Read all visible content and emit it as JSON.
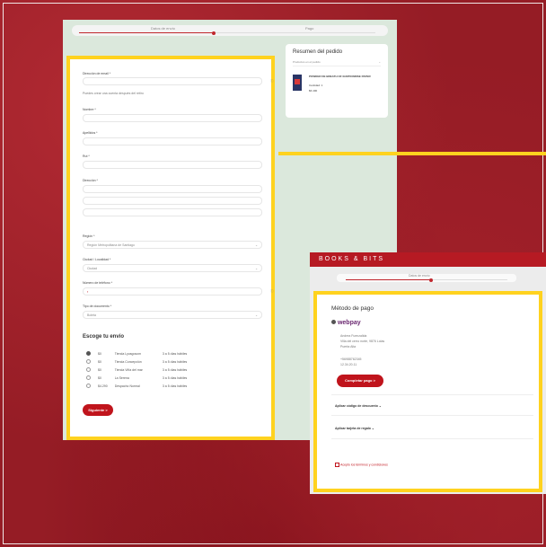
{
  "checkout_form": {
    "progress_label": "Datos de envío",
    "progress_label_right": "Pago",
    "email_label": "Dirección de email *",
    "account_hint": "Puedes crear una cuenta después del retiro",
    "first_name_label": "Nombre *",
    "last_name_label": "Apellidos *",
    "rut_label": "Rut *",
    "address_label": "Dirección *",
    "region_label": "Región *",
    "region_placeholder": "Región Metropolitana de Santiago",
    "city_label": "Ciudad / Localidad *",
    "city_placeholder": "Ciudad",
    "phone_label": "Número de teléfono *",
    "document_label": "Tipo de documento *",
    "document_value": "Boleta",
    "shipping_title": "Escoge tu envío",
    "shipping_options": [
      {
        "price": "$0",
        "name": "Tienda Lyosgosom",
        "time": "3 a 5 días hábiles",
        "selected": true
      },
      {
        "price": "$0",
        "name": "Tienda Concepción",
        "time": "3 a 5 días hábiles",
        "selected": false
      },
      {
        "price": "$0",
        "name": "Tienda Viña del mar",
        "time": "3 a 5 días hábiles",
        "selected": false
      },
      {
        "price": "$0",
        "name": "La Serena",
        "time": "3 a 5 días hábiles",
        "selected": false
      },
      {
        "price": "$4.290",
        "name": "Despacho Normal",
        "time": "3 a 5 días hábiles",
        "selected": false
      }
    ],
    "next_button": "Siguiente >"
  },
  "order_summary": {
    "title": "Resumen del pedido",
    "toggle": "Productos en el pedido",
    "product_name": "POWDER DE BREATH OF IGNITIONRISE PAPER",
    "product_meta": "Cantidad: 1",
    "product_price": "$6.490"
  },
  "payment": {
    "brand": "BOOKS & BITS",
    "progress_label": "Datos de envío",
    "title": "Método de pago",
    "webpay_logo": "webpay",
    "details": [
      "Andrea Fuenzalida",
      "Villa del cerro norte, 9876 Lolas",
      "Puerta Alta"
    ],
    "details2": [
      "+56988762345",
      "12.34.20.11"
    ],
    "pay_button": "Completar pago >",
    "discount_label": "Aplicar código de descuento  ⌄",
    "gift_label": "Aplicar tarjeta de regalo  ⌄",
    "terms": "Acepto los términos y condiciones"
  },
  "colors": {
    "accent": "#c0141c",
    "highlight": "#ffd21f",
    "brand_banner": "#b61a23"
  }
}
